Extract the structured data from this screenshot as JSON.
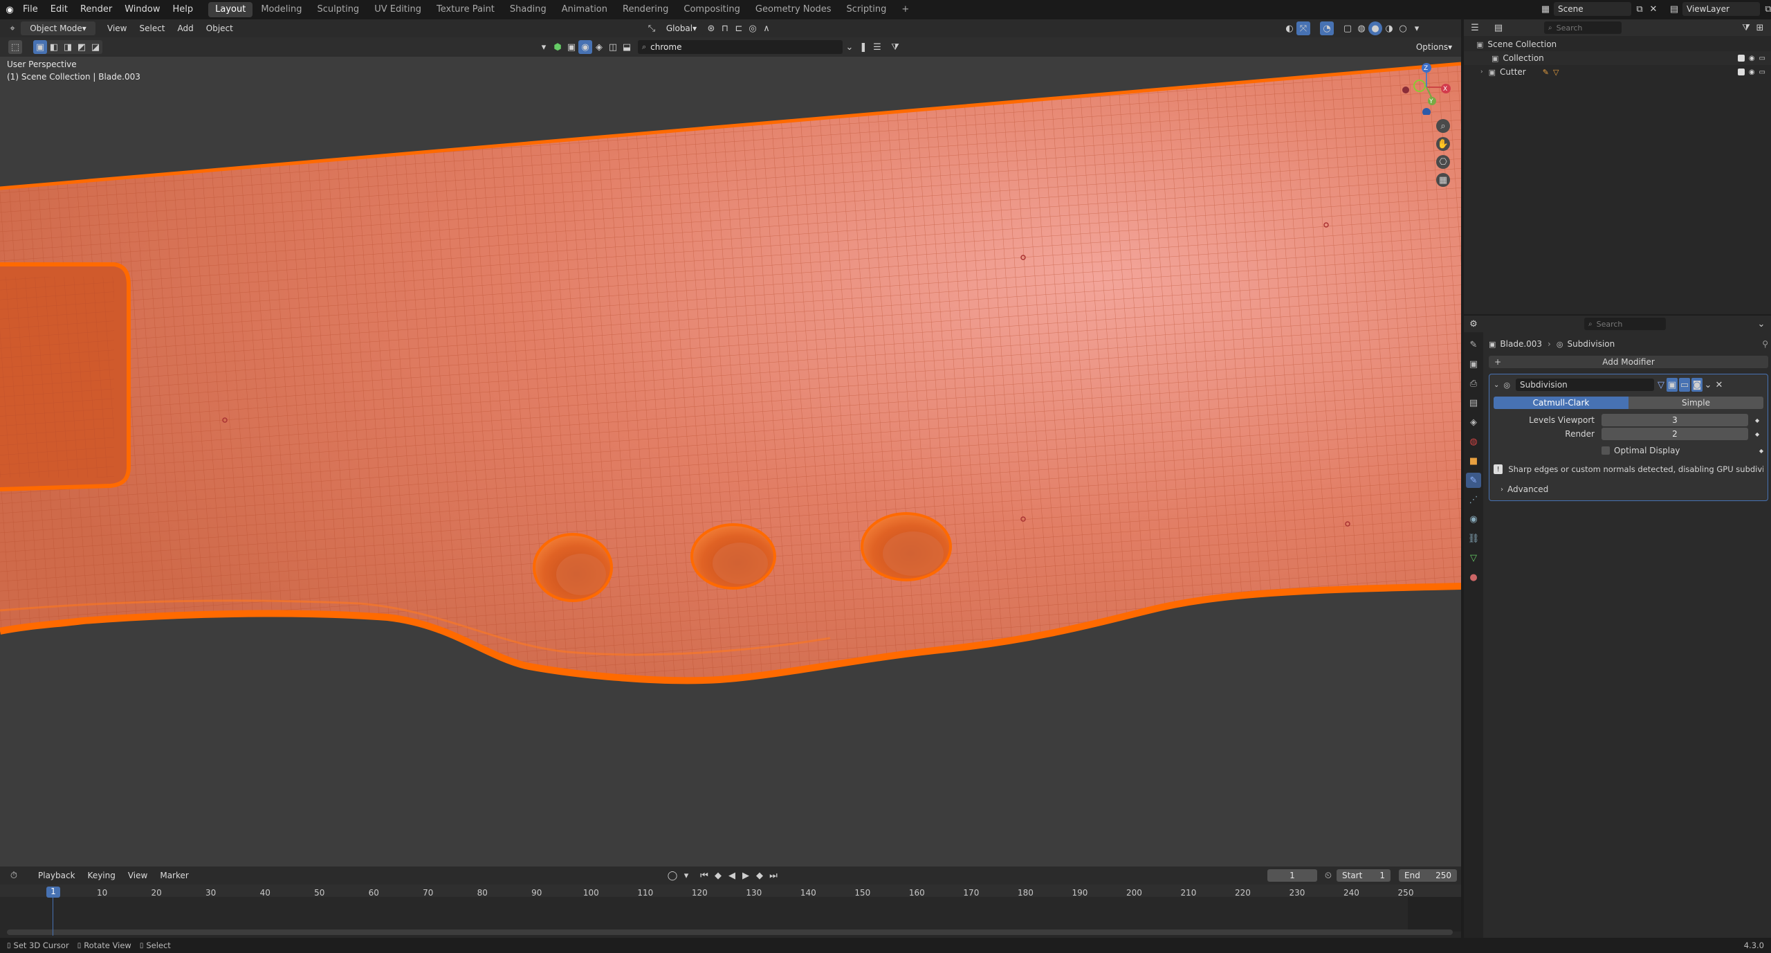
{
  "app": {
    "version": "4.3.0"
  },
  "menubar": {
    "items": [
      "File",
      "Edit",
      "Render",
      "Window",
      "Help"
    ],
    "workspaces": [
      "Layout",
      "Modeling",
      "Sculpting",
      "UV Editing",
      "Texture Paint",
      "Shading",
      "Animation",
      "Rendering",
      "Compositing",
      "Geometry Nodes",
      "Scripting"
    ],
    "active_workspace": "Layout",
    "add_tab": "+",
    "scene": "Scene",
    "view_layer": "ViewLayer"
  },
  "viewport_header": {
    "mode": "Object Mode",
    "menus": [
      "View",
      "Select",
      "Add",
      "Object"
    ],
    "transform_orientation": "Global",
    "search_value": "chrome",
    "options": "Options"
  },
  "viewport": {
    "perspective_label": "User Perspective",
    "collection_label": "(1) Scene Collection | Blade.003",
    "gizmo": {
      "x": "X",
      "y": "Y",
      "z": "Z"
    },
    "mesh_color": "#e87a62",
    "wire_color": "#ff6a00"
  },
  "outliner": {
    "search_placeholder": "Search",
    "root": "Scene Collection",
    "items": [
      "Collection",
      "Cutter"
    ]
  },
  "properties": {
    "search_placeholder": "Search",
    "breadcrumb_object": "Blade.003",
    "breadcrumb_modifier": "Subdivision",
    "add_modifier": "Add Modifier",
    "modifier_name": "Subdivision",
    "type_options": [
      "Catmull-Clark",
      "Simple"
    ],
    "active_type": "Catmull-Clark",
    "levels_viewport_label": "Levels Viewport",
    "levels_viewport_value": "3",
    "render_label": "Render",
    "render_value": "2",
    "optimal_display": "Optimal Display",
    "warning": "Sharp edges or custom normals detected, disabling GPU subdivis...",
    "advanced": "Advanced"
  },
  "timeline": {
    "menus": [
      "Playback",
      "Keying",
      "View",
      "Marker"
    ],
    "current_frame": "1",
    "start_label": "Start",
    "start_value": "1",
    "end_label": "End",
    "end_value": "250",
    "ticks": [
      "1",
      "10",
      "20",
      "30",
      "40",
      "50",
      "60",
      "70",
      "80",
      "90",
      "100",
      "110",
      "120",
      "130",
      "140",
      "150",
      "160",
      "170",
      "180",
      "190",
      "200",
      "210",
      "220",
      "230",
      "240",
      "250"
    ]
  },
  "statusbar": {
    "items": [
      "Set 3D Cursor",
      "Rotate View",
      "Select"
    ]
  }
}
